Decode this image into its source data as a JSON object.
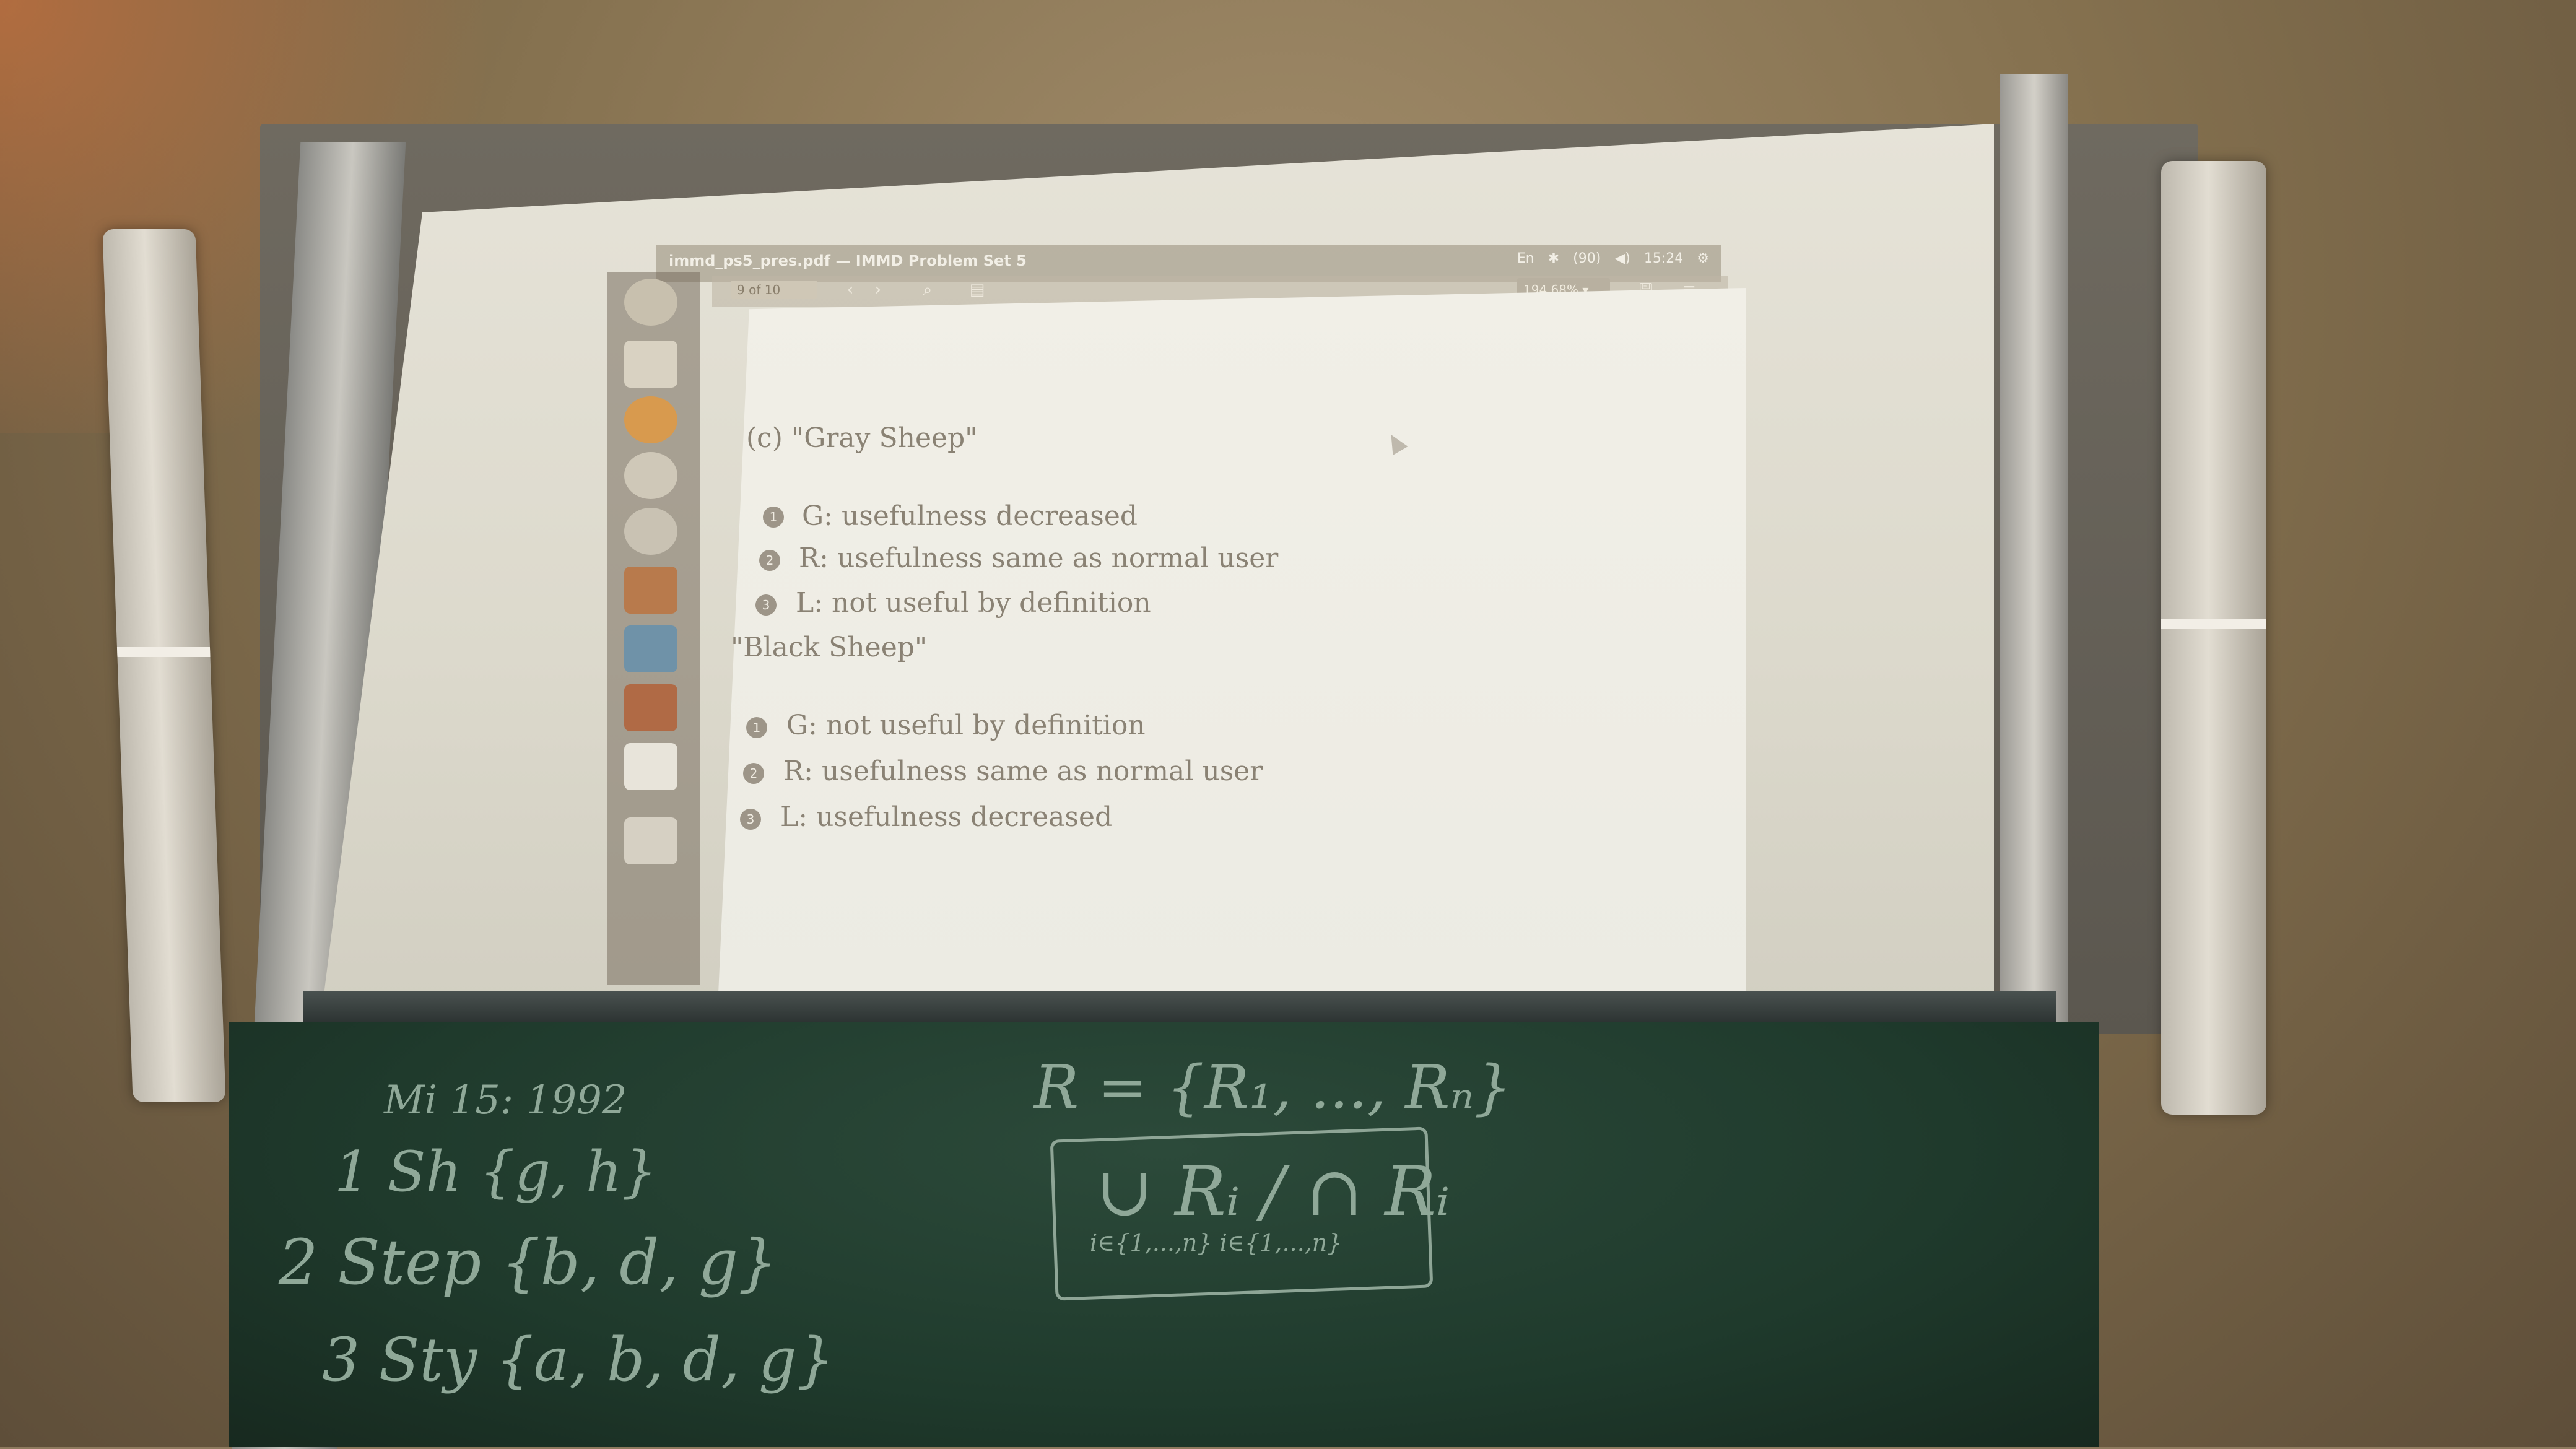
{
  "window": {
    "title": "immd_ps5_pres.pdf — IMMD Problem Set 5",
    "status": [
      "En",
      "✱",
      "(90)",
      "◀)",
      "15:24",
      "⚙"
    ]
  },
  "viewer": {
    "page_field": "9     of 10",
    "zoom": "194.68% ▾",
    "buttons": {
      "prev": "‹",
      "next": "›",
      "search": "⌕",
      "sidebar": "▤",
      "save": "🖫",
      "menu": "≡"
    }
  },
  "slide": {
    "heading_gray": "(c) \"Gray Sheep\"",
    "gray_items": [
      {
        "num": "1",
        "text": "G: usefulness decreased"
      },
      {
        "num": "2",
        "text": "R: usefulness same as normal user"
      },
      {
        "num": "3",
        "text": "L: not useful by definition"
      }
    ],
    "heading_black": "\"Black Sheep\"",
    "black_items": [
      {
        "num": "1",
        "text": "G: not useful by definition"
      },
      {
        "num": "2",
        "text": "R: usefulness same as normal user"
      },
      {
        "num": "3",
        "text": "L: usefulness decreased"
      }
    ]
  },
  "blackboard": {
    "left_lines": [
      "Mi  15:  1992",
      "1 Sh    {g, h}",
      "2 Step  {b, d, g}",
      "3 Sty   {a, b, d, g}"
    ],
    "formula_top": "R = {R₁, ..., Rₙ}",
    "formula_box": "∪ Rᵢ  /  ∩ Rᵢ",
    "formula_sub": "i∈{1,...,n}    i∈{1,...,n}"
  },
  "colors": {
    "slide_text": "#8a8274",
    "board": "#1f3a2c",
    "chalk": "#8fa898"
  }
}
